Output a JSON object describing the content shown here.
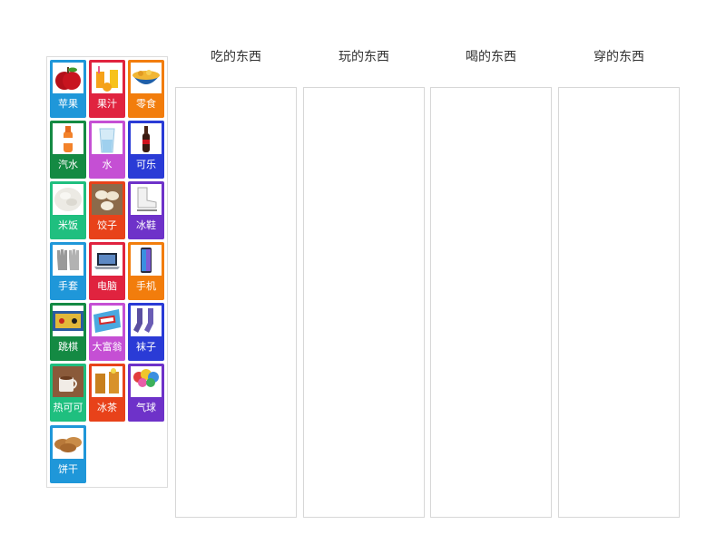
{
  "palette": {
    "cards": [
      {
        "label": "苹果",
        "color": "#1f97d9",
        "icon": "apple-icon"
      },
      {
        "label": "果汁",
        "color": "#e0233f",
        "icon": "juice-icon"
      },
      {
        "label": "零食",
        "color": "#f27d0c",
        "icon": "snack-icon"
      },
      {
        "label": "汽水",
        "color": "#148a43",
        "icon": "soda-icon"
      },
      {
        "label": "水",
        "color": "#c54fd4",
        "icon": "water-icon"
      },
      {
        "label": "可乐",
        "color": "#2a3bd6",
        "icon": "cola-icon"
      },
      {
        "label": "米饭",
        "color": "#1fbf7f",
        "icon": "rice-icon"
      },
      {
        "label": "饺子",
        "color": "#e8421a",
        "icon": "dumpling-icon"
      },
      {
        "label": "冰鞋",
        "color": "#6e32c9",
        "icon": "ice-skate-icon"
      },
      {
        "label": "手套",
        "color": "#1f97d9",
        "icon": "glove-icon"
      },
      {
        "label": "电脑",
        "color": "#e0233f",
        "icon": "laptop-icon"
      },
      {
        "label": "手机",
        "color": "#f27d0c",
        "icon": "phone-icon"
      },
      {
        "label": "跳棋",
        "color": "#148a43",
        "icon": "checkers-icon"
      },
      {
        "label": "大富翁",
        "color": "#c54fd4",
        "icon": "monopoly-icon"
      },
      {
        "label": "袜子",
        "color": "#2a3bd6",
        "icon": "socks-icon"
      },
      {
        "label": "热可可",
        "color": "#1fbf7f",
        "icon": "hot-cocoa-icon"
      },
      {
        "label": "冰茶",
        "color": "#e8421a",
        "icon": "iced-tea-icon"
      },
      {
        "label": "气球",
        "color": "#6e32c9",
        "icon": "balloon-icon"
      },
      {
        "label": "饼干",
        "color": "#1f97d9",
        "icon": "cookie-icon"
      }
    ]
  },
  "columns": [
    {
      "title": "吃的东西"
    },
    {
      "title": "玩的东西"
    },
    {
      "title": "喝的东西"
    },
    {
      "title": "穿的东西"
    }
  ]
}
